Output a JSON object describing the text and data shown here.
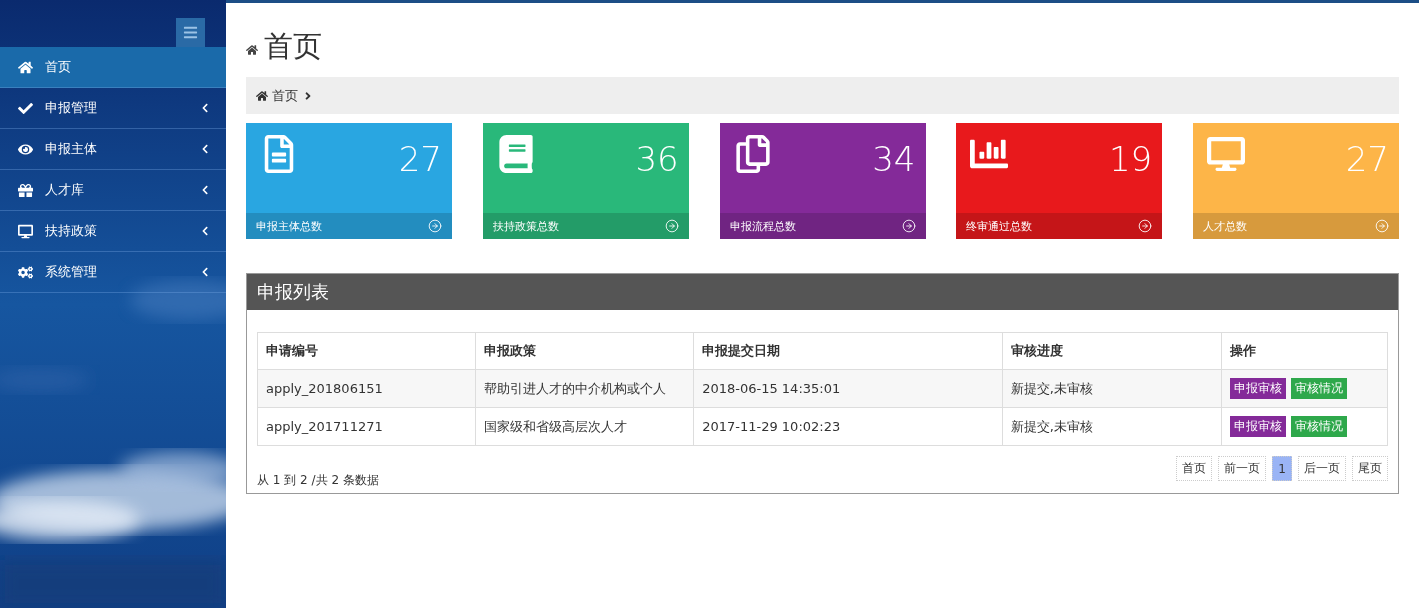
{
  "sidebar": {
    "items": [
      {
        "label": "首页",
        "kind": "link",
        "selected": true
      },
      {
        "label": "申报管理",
        "kind": "group",
        "selected": false
      },
      {
        "label": "申报主体",
        "kind": "group",
        "selected": false
      },
      {
        "label": "人才库",
        "kind": "group",
        "selected": false
      },
      {
        "label": "扶持政策",
        "kind": "group",
        "selected": false
      },
      {
        "label": "系统管理",
        "kind": "group",
        "selected": false
      }
    ]
  },
  "page": {
    "title": "首页",
    "breadcrumb": [
      "首页"
    ]
  },
  "stats": [
    {
      "value": "27",
      "label": "申报主体总数",
      "color": "#29a6e1"
    },
    {
      "value": "36",
      "label": "扶持政策总数",
      "color": "#29b87a"
    },
    {
      "value": "34",
      "label": "申报流程总数",
      "color": "#842a99"
    },
    {
      "value": "19",
      "label": "终审通过总数",
      "color": "#e8191c"
    },
    {
      "value": "27",
      "label": "人才总数",
      "color": "#fdb548"
    }
  ],
  "panel": {
    "title": "申报列表",
    "table": {
      "columns": [
        "申请编号",
        "申报政策",
        "申报提交日期",
        "审核进度",
        "操作"
      ],
      "rows": [
        {
          "id": "apply_201806151",
          "policy": "帮助引进人才的中介机构或个人",
          "date": "2018-06-15 14:35:01",
          "status": "新提交,未审核",
          "actions": [
            "申报审核",
            "审核情况"
          ]
        },
        {
          "id": "apply_201711271",
          "policy": "国家级和省级高层次人才",
          "date": "2017-11-29 10:02:23",
          "status": "新提交,未审核",
          "actions": [
            "申报审核",
            "审核情况"
          ]
        }
      ]
    },
    "summary": "从 1 到 2 /共 2 条数据",
    "pagination": [
      {
        "label": "首页",
        "selected": false
      },
      {
        "label": "前一页",
        "selected": false
      },
      {
        "label": "1",
        "selected": true
      },
      {
        "label": "后一页",
        "selected": false
      },
      {
        "label": "尾页",
        "selected": false
      }
    ]
  }
}
